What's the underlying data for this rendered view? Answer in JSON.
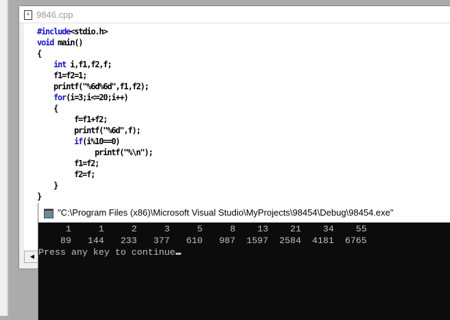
{
  "editor": {
    "title": "9846.cpp",
    "lines": [
      {
        "indent": 0,
        "kw": "#include",
        "rest": "<stdio.h>"
      },
      {
        "indent": 0,
        "kw": "void",
        "rest": " main()"
      },
      {
        "indent": 0,
        "kw": "",
        "rest": "{"
      },
      {
        "indent": 4,
        "kw": "int",
        "rest": " i,f1,f2,f;"
      },
      {
        "indent": 4,
        "kw": "",
        "rest": "f1=f2=1;"
      },
      {
        "indent": 4,
        "kw": "",
        "rest": "printf(\"%6d%6d\",f1,f2);"
      },
      {
        "indent": 4,
        "kw": "for",
        "rest": "(i=3;i<=20;i++)"
      },
      {
        "indent": 4,
        "kw": "",
        "rest": "{"
      },
      {
        "indent": 9,
        "kw": "",
        "rest": "f=f1+f2;"
      },
      {
        "indent": 9,
        "kw": "",
        "rest": "printf(\"%6d\",f);"
      },
      {
        "indent": 9,
        "kw": "if",
        "rest": "(i%10==0)"
      },
      {
        "indent": 14,
        "kw": "",
        "rest": "printf(\"%\\n\");"
      },
      {
        "indent": 9,
        "kw": "",
        "rest": "f1=f2;"
      },
      {
        "indent": 9,
        "kw": "",
        "rest": "f2=f;"
      },
      {
        "indent": 4,
        "kw": "",
        "rest": "}"
      },
      {
        "indent": 0,
        "kw": "",
        "rest": "}"
      }
    ]
  },
  "console": {
    "title": "\"C:\\Program Files (x86)\\Microsoft Visual Studio\\MyProjects\\98454\\Debug\\98454.exe\"",
    "lines": [
      "     1     1     2     3     5     8    13    21    34    55",
      "    89   144   233   377   610   987  1597  2584  4181  6765",
      "Press any key to continue"
    ]
  }
}
